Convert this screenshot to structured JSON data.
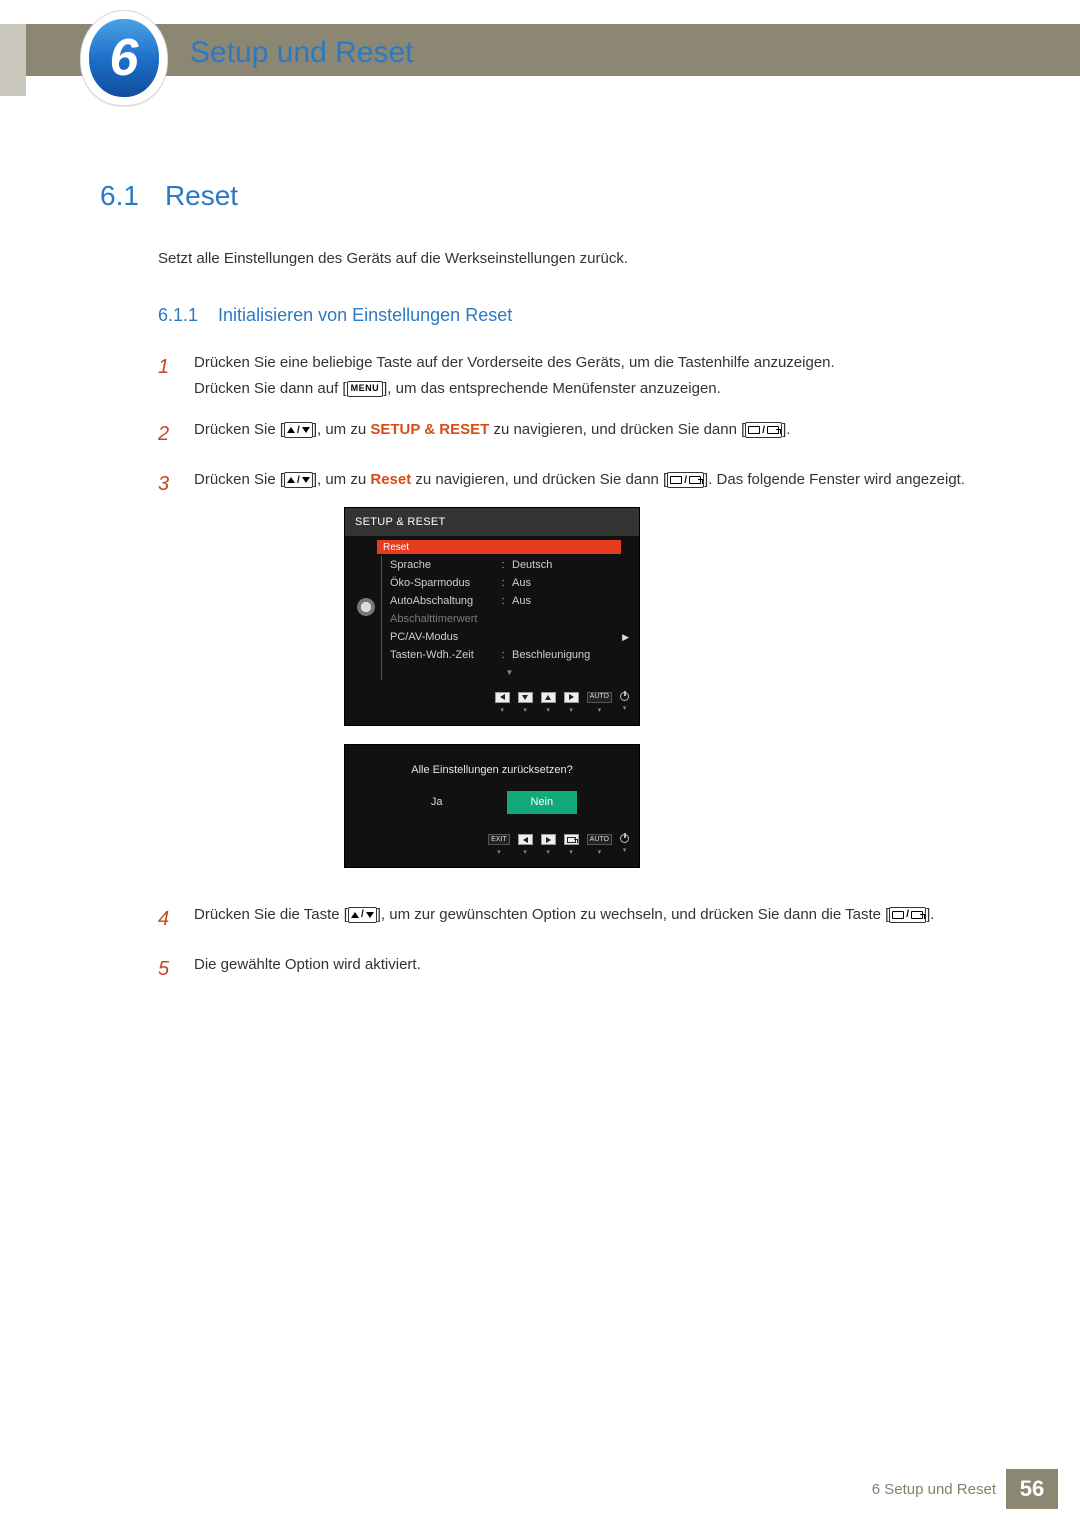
{
  "header": {
    "chapter_number": "6",
    "chapter_title": "Setup und Reset"
  },
  "section": {
    "number": "6.1",
    "title": "Reset",
    "intro": "Setzt alle Einstellungen des Geräts auf die Werkseinstellungen zurück."
  },
  "subsection": {
    "number": "6.1.1",
    "title": "Initialisieren von Einstellungen Reset"
  },
  "steps": {
    "s1": {
      "num": "1",
      "line1": "Drücken Sie eine beliebige Taste auf der Vorderseite des Geräts, um die Tastenhilfe anzuzeigen.",
      "line2a": "Drücken Sie dann auf [",
      "menu_label": "MENU",
      "line2b": "], um das entsprechende Menüfenster anzuzeigen."
    },
    "s2": {
      "num": "2",
      "a": "Drücken Sie [",
      "b": "], um zu ",
      "kw": "SETUP & RESET",
      "c": " zu navigieren, und drücken Sie dann [",
      "d": "]."
    },
    "s3": {
      "num": "3",
      "a": "Drücken Sie [",
      "b": "], um zu ",
      "kw": "Reset",
      "c": " zu navigieren, und drücken Sie dann [",
      "d": "]. Das folgende Fenster wird angezeigt."
    },
    "s4": {
      "num": "4",
      "a": "Drücken Sie die Taste [",
      "b": "], um zur gewünschten Option zu wechseln, und drücken Sie dann die Taste [",
      "c": "]."
    },
    "s5": {
      "num": "5",
      "text": "Die gewählte Option wird aktiviert."
    }
  },
  "osd1": {
    "title": "SETUP & RESET",
    "highlight": "Reset",
    "rows": [
      {
        "label": "Sprache",
        "value": "Deutsch",
        "dim": false,
        "arrow": false
      },
      {
        "label": "Öko-Sparmodus",
        "value": "Aus",
        "dim": false,
        "arrow": false
      },
      {
        "label": "AutoAbschaltung",
        "value": "Aus",
        "dim": false,
        "arrow": false
      },
      {
        "label": "Abschalttimerwert",
        "value": "",
        "dim": true,
        "arrow": false
      },
      {
        "label": "PC/AV-Modus",
        "value": "",
        "dim": false,
        "arrow": true
      },
      {
        "label": "Tasten-Wdh.-Zeit",
        "value": "Beschleunigung",
        "dim": false,
        "arrow": false
      }
    ],
    "footer_auto": "AUTO"
  },
  "osd2": {
    "question": "Alle Einstellungen zurücksetzen?",
    "yes": "Ja",
    "no": "Nein",
    "exit": "EXIT",
    "auto": "AUTO"
  },
  "footer": {
    "text": "6 Setup und Reset",
    "page": "56"
  }
}
